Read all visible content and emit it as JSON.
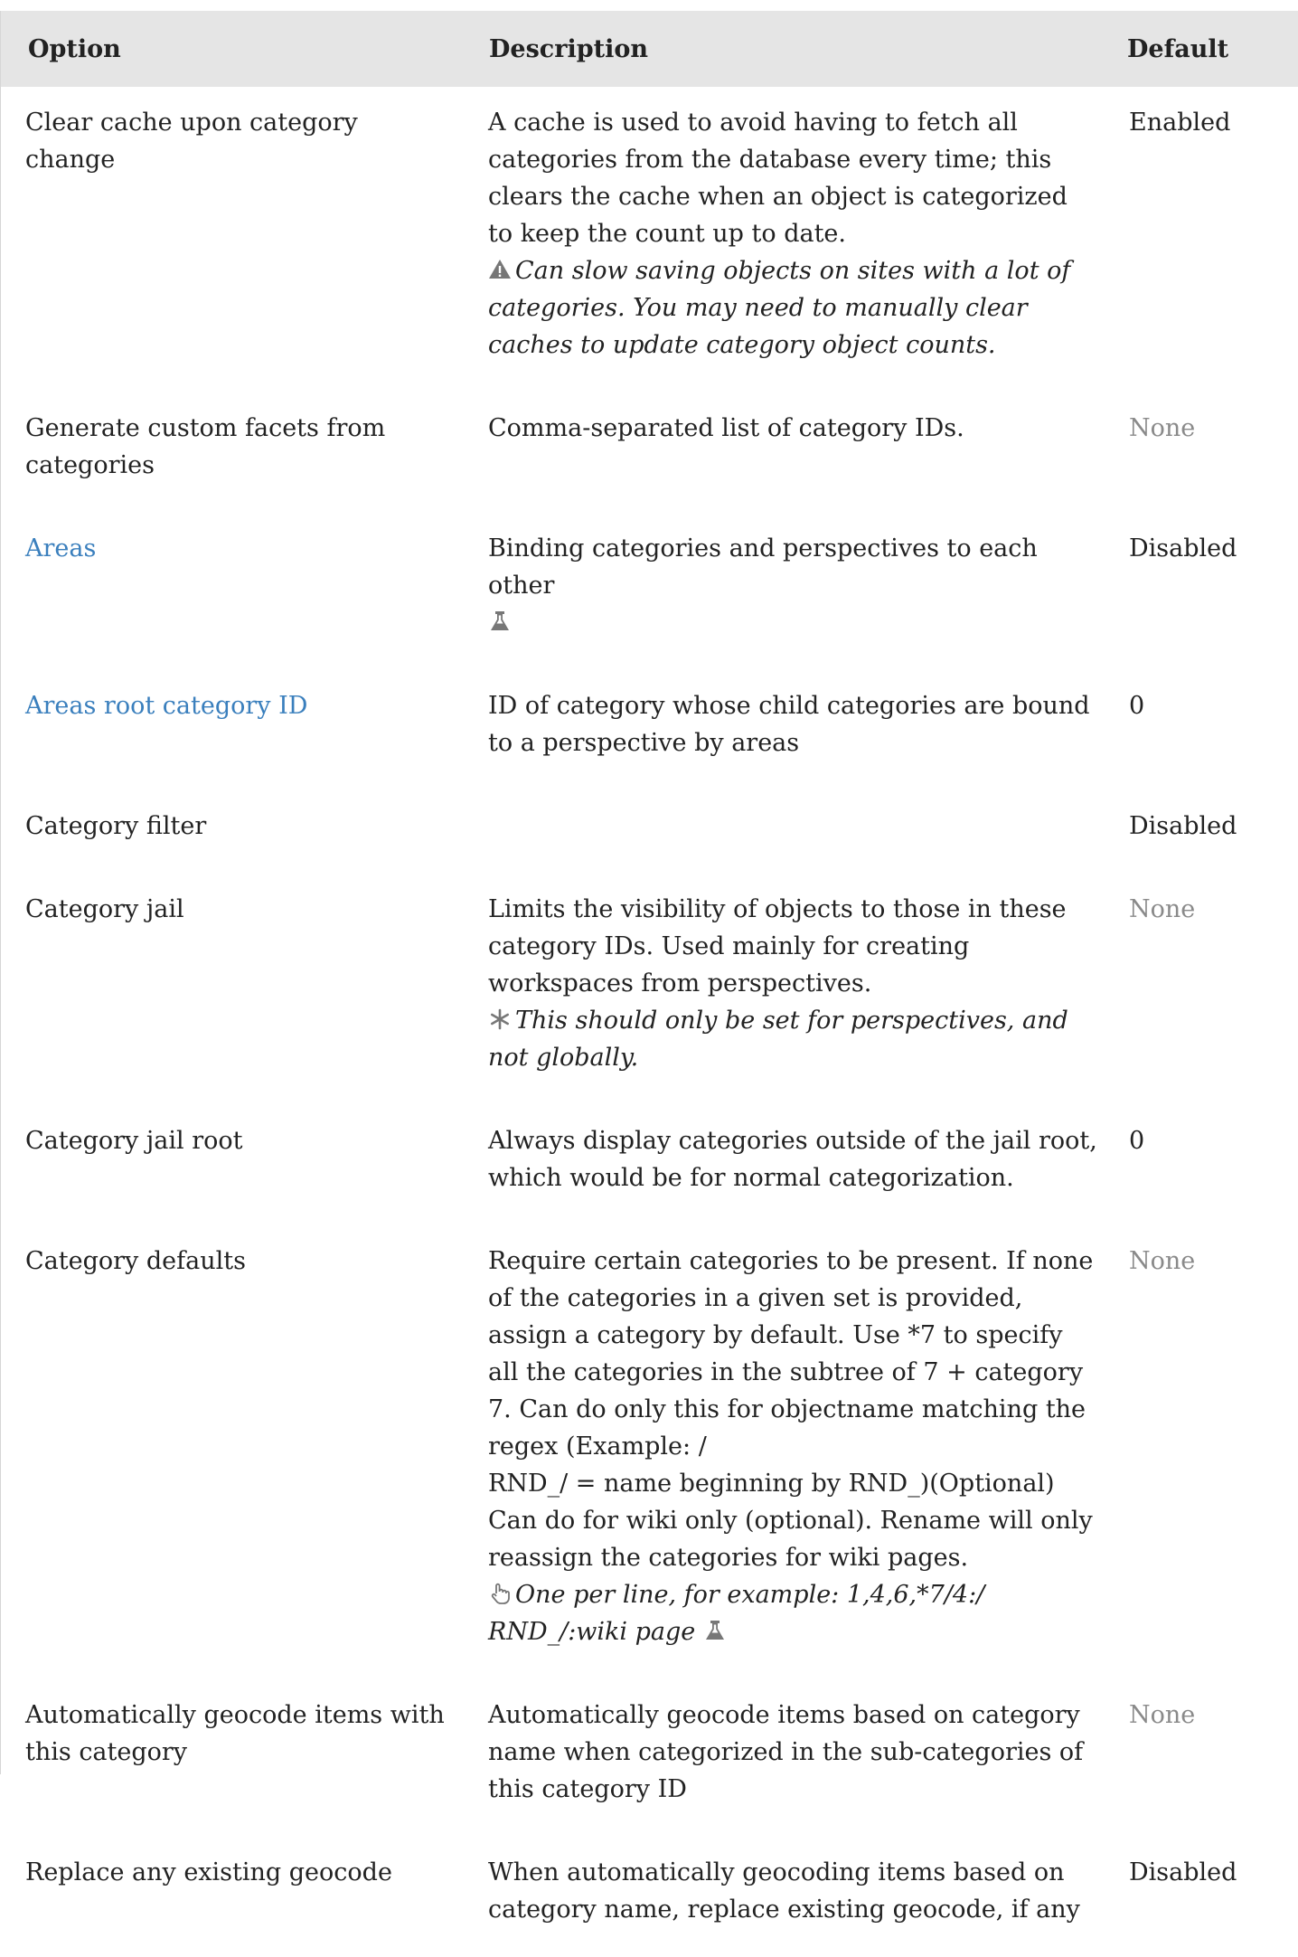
{
  "header": {
    "option": "Option",
    "description": "Description",
    "default": "Default"
  },
  "rows": [
    {
      "option": "Clear cache upon category change",
      "description": "A cache is used to avoid having to fetch all categories from the database every time; this clears the cache when an object is categorized to keep the count up to date.",
      "note": "Can slow saving objects on sites with a lot of categories. You may need to manually clear caches to update category object counts.",
      "default": "Enabled"
    },
    {
      "option": "Generate custom facets from categories",
      "description": "Comma-separated list of category IDs.",
      "default": "None"
    },
    {
      "option": "Areas",
      "description": "Binding categories and perspectives to each other",
      "default": "Disabled"
    },
    {
      "option": "Areas root category ID",
      "description": "ID of category whose child categories are bound to a perspective by areas",
      "default": "0"
    },
    {
      "option": "Category filter",
      "description": "",
      "default": "Disabled"
    },
    {
      "option": "Category jail",
      "description": "Limits the visibility of objects to those in these category IDs. Used mainly for creating workspaces from perspectives.",
      "note": "This should only be set for perspectives, and not globally.",
      "default": "None"
    },
    {
      "option": "Category jail root",
      "description": "Always display categories outside of the jail root, which would be for normal categorization.",
      "default": "0"
    },
    {
      "option": "Category defaults",
      "description": "Require certain categories to be present. If none of the categories in a given set is provided, assign a category by default. Use *7 to specify all the categories in the subtree of 7 + category 7. Can do only this for objectname matching the regex (Example: /",
      "description2": "RND_/ = name beginning by RND_)(Optional) Can do for wiki only (optional). Rename will only reassign the categories for wiki pages.",
      "note": "One per line, for example: 1,4,6,*7/4:/",
      "note2": "RND_/:wiki page",
      "default": "None"
    },
    {
      "option": "Automatically geocode items with this category",
      "description": "Automatically geocode items based on category name when categorized in the sub-categories of this category ID",
      "default": "None"
    },
    {
      "option": "Replace any existing geocode",
      "description": "When automatically geocoding items based on category name, replace existing geocode, if any",
      "default": "Disabled"
    }
  ],
  "colors": {
    "header_bg": "#e5e5e5",
    "link": "#3a7fbd",
    "muted": "#8a8a8a",
    "icon": "#777777"
  },
  "icons": [
    "warning-icon",
    "flask-icon",
    "asterisk-icon",
    "pointer-hand-icon"
  ]
}
